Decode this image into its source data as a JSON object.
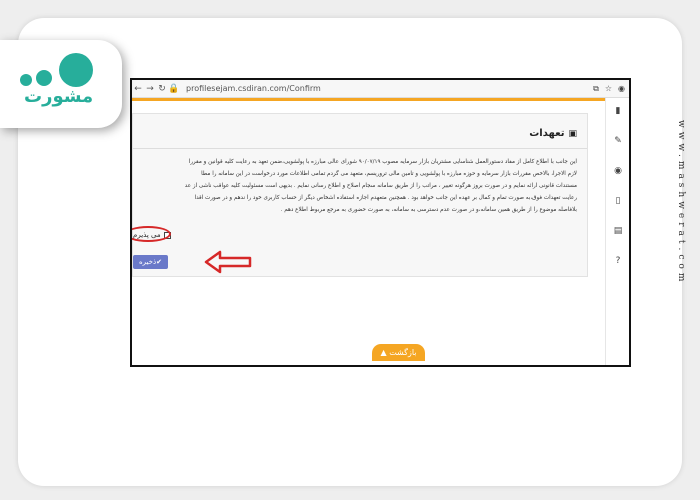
{
  "site": {
    "logo_text": "مشورت",
    "vertical_url": "www.mashwerat.com"
  },
  "browser": {
    "url": "profilesejam.csdiran.com/Confirm"
  },
  "panel": {
    "title": "تعهدات",
    "lines": [
      "این جانب با اطلاع کامل از مفاد دستورالعمل شناسایی مشتریان بازار سرمایه مصوب ۹۰/۰۷/۱۹ شورای عالی مبارزه با پولشویی،ضمن تعهد به رعایت کلیه قوانین و مقررا",
      "لازم الاجرا، بالاخص مقررات بازار سرمایه و حوزه مبارزه با پولشویی و تامین مالی تروریسم، متعهد می گردم تمامی اطلاعات مورد درخواست در این سامانه را مطا",
      "مستندات قانونی ارائه نمایم و در صورت بروز هرگونه تغییر ، مراتب را از طریق سامانه سجام اصلاح و اطلاع رسانی نمایم . بدیهی است مسئولیت کلیه عواقب ناشی از عد",
      "رعایت تعهدات فوق،به صورت تمام و کمال بر عهده این جانب خواهد بود . همچنین متعهدم اجازه استفاده اشخاص دیگر از حساب کاربری خود را ندهم و در صورت اقدا",
      "بلافاصله موضوع را از طریق همین سامانه،و در صورت عدم دسترسی به سامانه، به صورت حضوری به مرجع مربوط اطلاع دهم ."
    ],
    "checkbox_label": "می پذیرم",
    "save_label": "ذخیره"
  },
  "back_button": {
    "label": "بازگشت"
  },
  "colors": {
    "accent_orange": "#f5a623",
    "save_blue": "#6a79c9",
    "annotation_red": "#d62828",
    "logo_teal": "#27ae9b"
  },
  "sidebar_icons": [
    "book-icon",
    "edit-icon",
    "eye-icon",
    "mobile-icon",
    "document-icon",
    "help-icon"
  ]
}
